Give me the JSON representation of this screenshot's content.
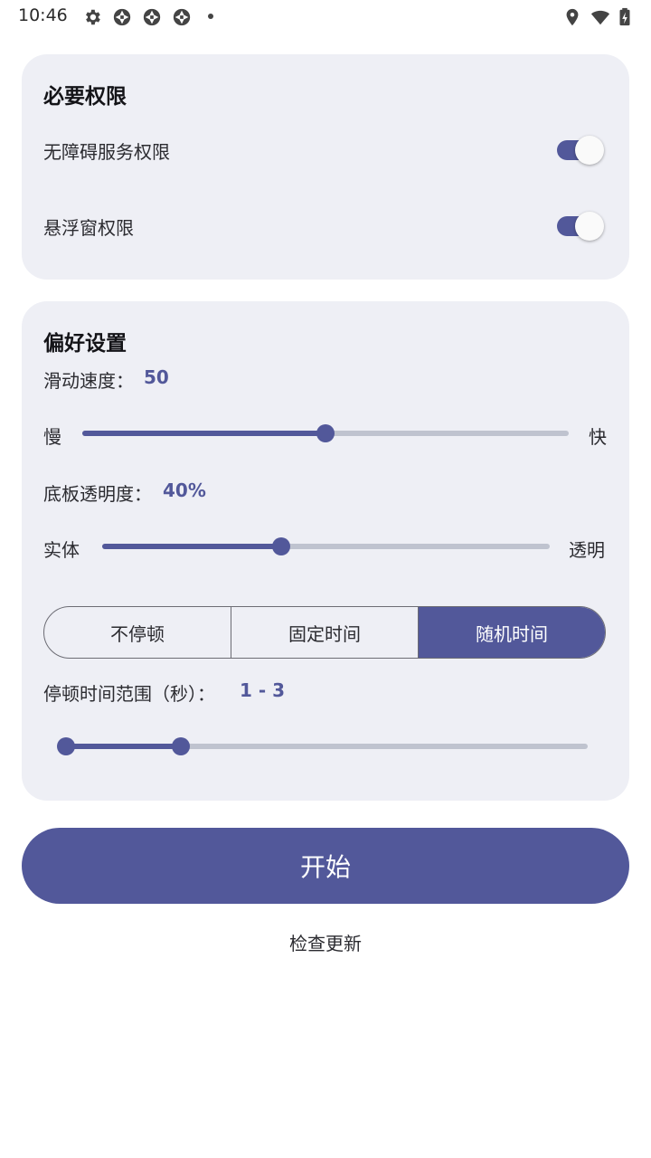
{
  "status_bar": {
    "time": "10:46",
    "left_icons": [
      "gear-icon",
      "app-icon",
      "app-icon",
      "app-icon",
      "dot-icon"
    ],
    "right_icons": [
      "location-icon",
      "wifi-icon",
      "battery-icon"
    ]
  },
  "permissions": {
    "title": "必要权限",
    "items": [
      {
        "label": "无障碍服务权限",
        "enabled": true
      },
      {
        "label": "悬浮窗权限",
        "enabled": true
      }
    ]
  },
  "preferences": {
    "title": "偏好设置",
    "speed": {
      "label": "滑动速度：",
      "value": "50",
      "fraction": 0.5,
      "min_label": "慢",
      "max_label": "快"
    },
    "opacity": {
      "label": "底板透明度：",
      "value": "40%",
      "fraction": 0.4,
      "min_label": "实体",
      "max_label": "透明"
    },
    "pause_mode": {
      "options": [
        "不停顿",
        "固定时间",
        "随机时间"
      ],
      "selected": 2
    },
    "pause_range": {
      "label": "停顿时间范围（秒）：",
      "value": "1 - 3",
      "low_fraction": 0.0,
      "high_fraction": 0.22
    }
  },
  "start_button": {
    "label": "开始"
  },
  "update_link": {
    "label": "检查更新"
  },
  "colors": {
    "accent": "#52589a",
    "card": "#eeeff5",
    "track": "#bfc3cf"
  }
}
